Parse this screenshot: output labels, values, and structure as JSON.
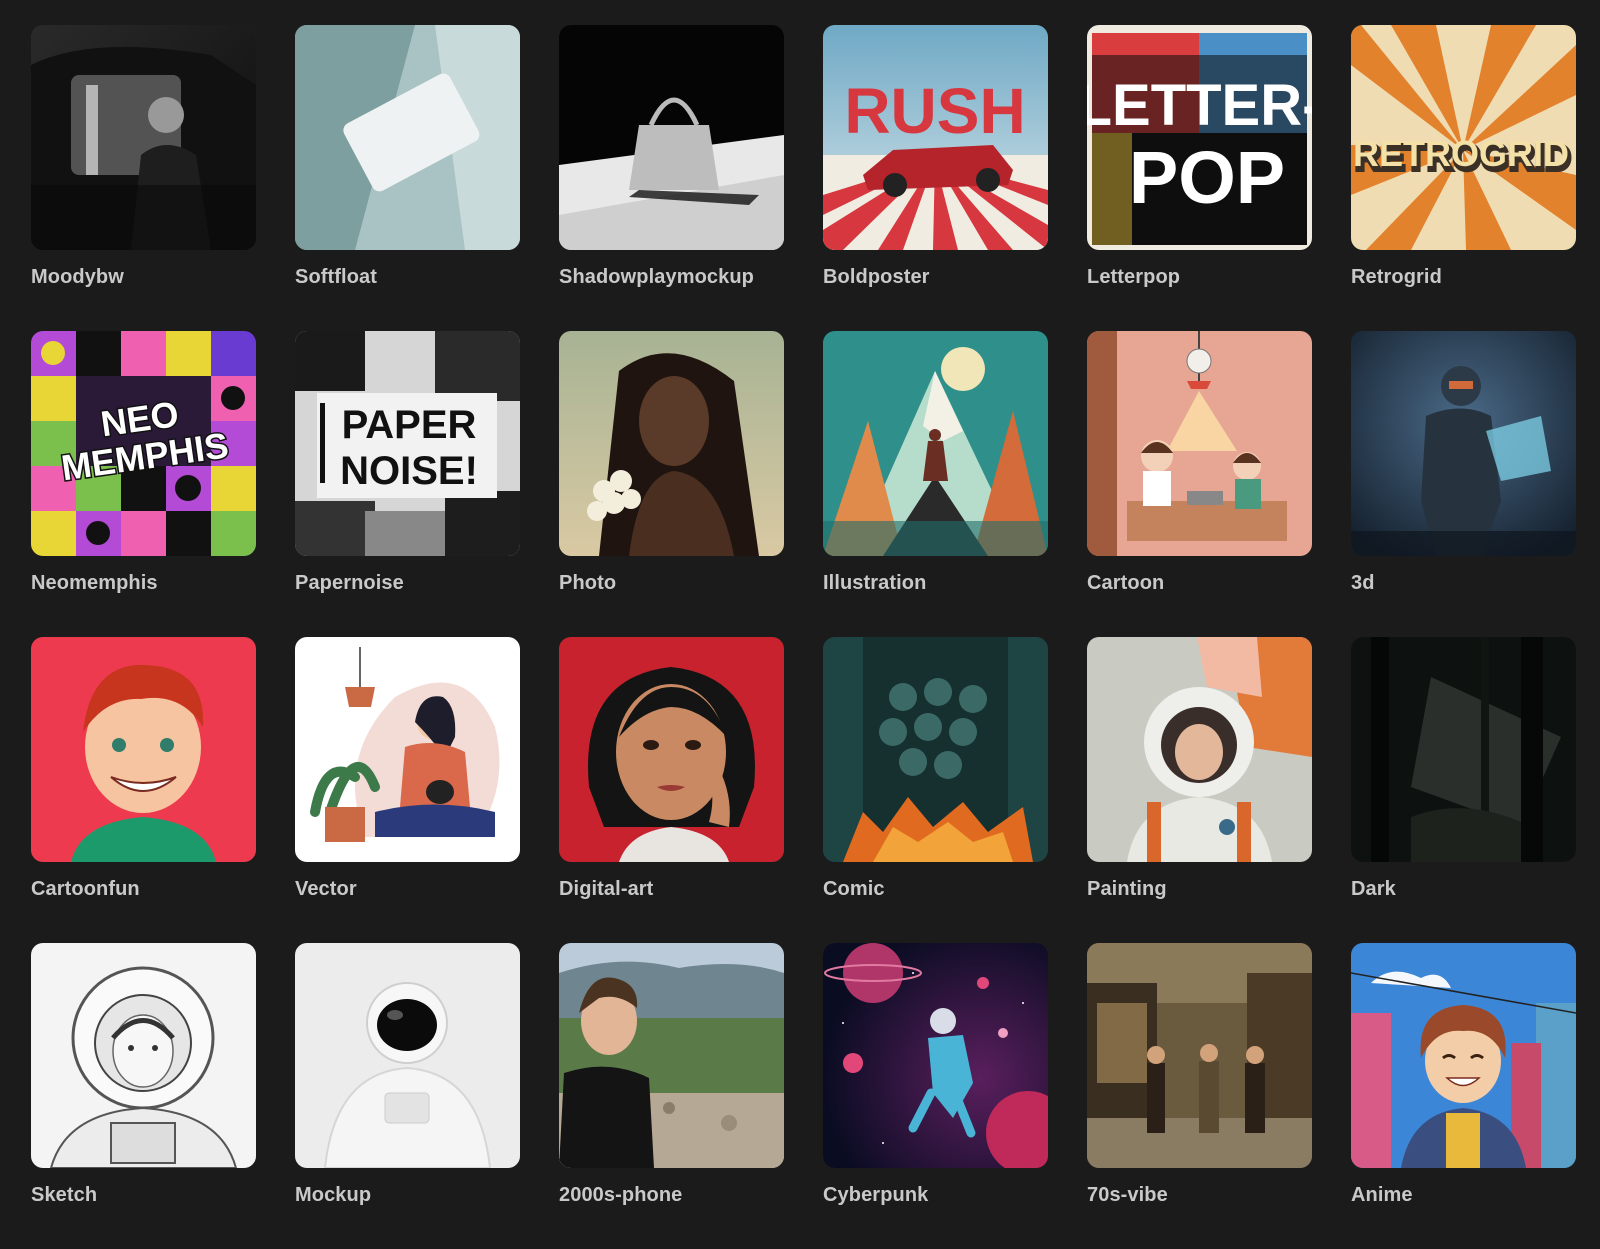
{
  "styles": [
    {
      "label": "Moodybw",
      "icon": "moodybw-thumbnail-icon"
    },
    {
      "label": "Softfloat",
      "icon": "softfloat-thumbnail-icon"
    },
    {
      "label": "Shadowplaymockup",
      "icon": "shadowplaymockup-thumbnail-icon"
    },
    {
      "label": "Boldposter",
      "icon": "boldposter-thumbnail-icon",
      "art_text": "RUSH"
    },
    {
      "label": "Letterpop",
      "icon": "letterpop-thumbnail-icon",
      "art_text": [
        "LETTER-",
        "POP"
      ]
    },
    {
      "label": "Retrogrid",
      "icon": "retrogrid-thumbnail-icon",
      "art_text": "RETROGRID"
    },
    {
      "label": "Neomemphis",
      "icon": "neomemphis-thumbnail-icon",
      "art_text": [
        "NEO",
        "MEMPHIS"
      ]
    },
    {
      "label": "Papernoise",
      "icon": "papernoise-thumbnail-icon",
      "art_text": [
        "PAPER",
        "NOISE!"
      ]
    },
    {
      "label": "Photo",
      "icon": "photo-thumbnail-icon"
    },
    {
      "label": "Illustration",
      "icon": "illustration-thumbnail-icon"
    },
    {
      "label": "Cartoon",
      "icon": "cartoon-thumbnail-icon"
    },
    {
      "label": "3d",
      "icon": "3d-thumbnail-icon"
    },
    {
      "label": "Cartoonfun",
      "icon": "cartoonfun-thumbnail-icon"
    },
    {
      "label": "Vector",
      "icon": "vector-thumbnail-icon"
    },
    {
      "label": "Digital-art",
      "icon": "digital-art-thumbnail-icon"
    },
    {
      "label": "Comic",
      "icon": "comic-thumbnail-icon"
    },
    {
      "label": "Painting",
      "icon": "painting-thumbnail-icon"
    },
    {
      "label": "Dark",
      "icon": "dark-thumbnail-icon"
    },
    {
      "label": "Sketch",
      "icon": "sketch-thumbnail-icon"
    },
    {
      "label": "Mockup",
      "icon": "mockup-thumbnail-icon"
    },
    {
      "label": "2000s-phone",
      "icon": "2000s-phone-thumbnail-icon"
    },
    {
      "label": "Cyberpunk",
      "icon": "cyberpunk-thumbnail-icon"
    },
    {
      "label": "70s-vibe",
      "icon": "70s-vibe-thumbnail-icon"
    },
    {
      "label": "Anime",
      "icon": "anime-thumbnail-icon"
    }
  ]
}
